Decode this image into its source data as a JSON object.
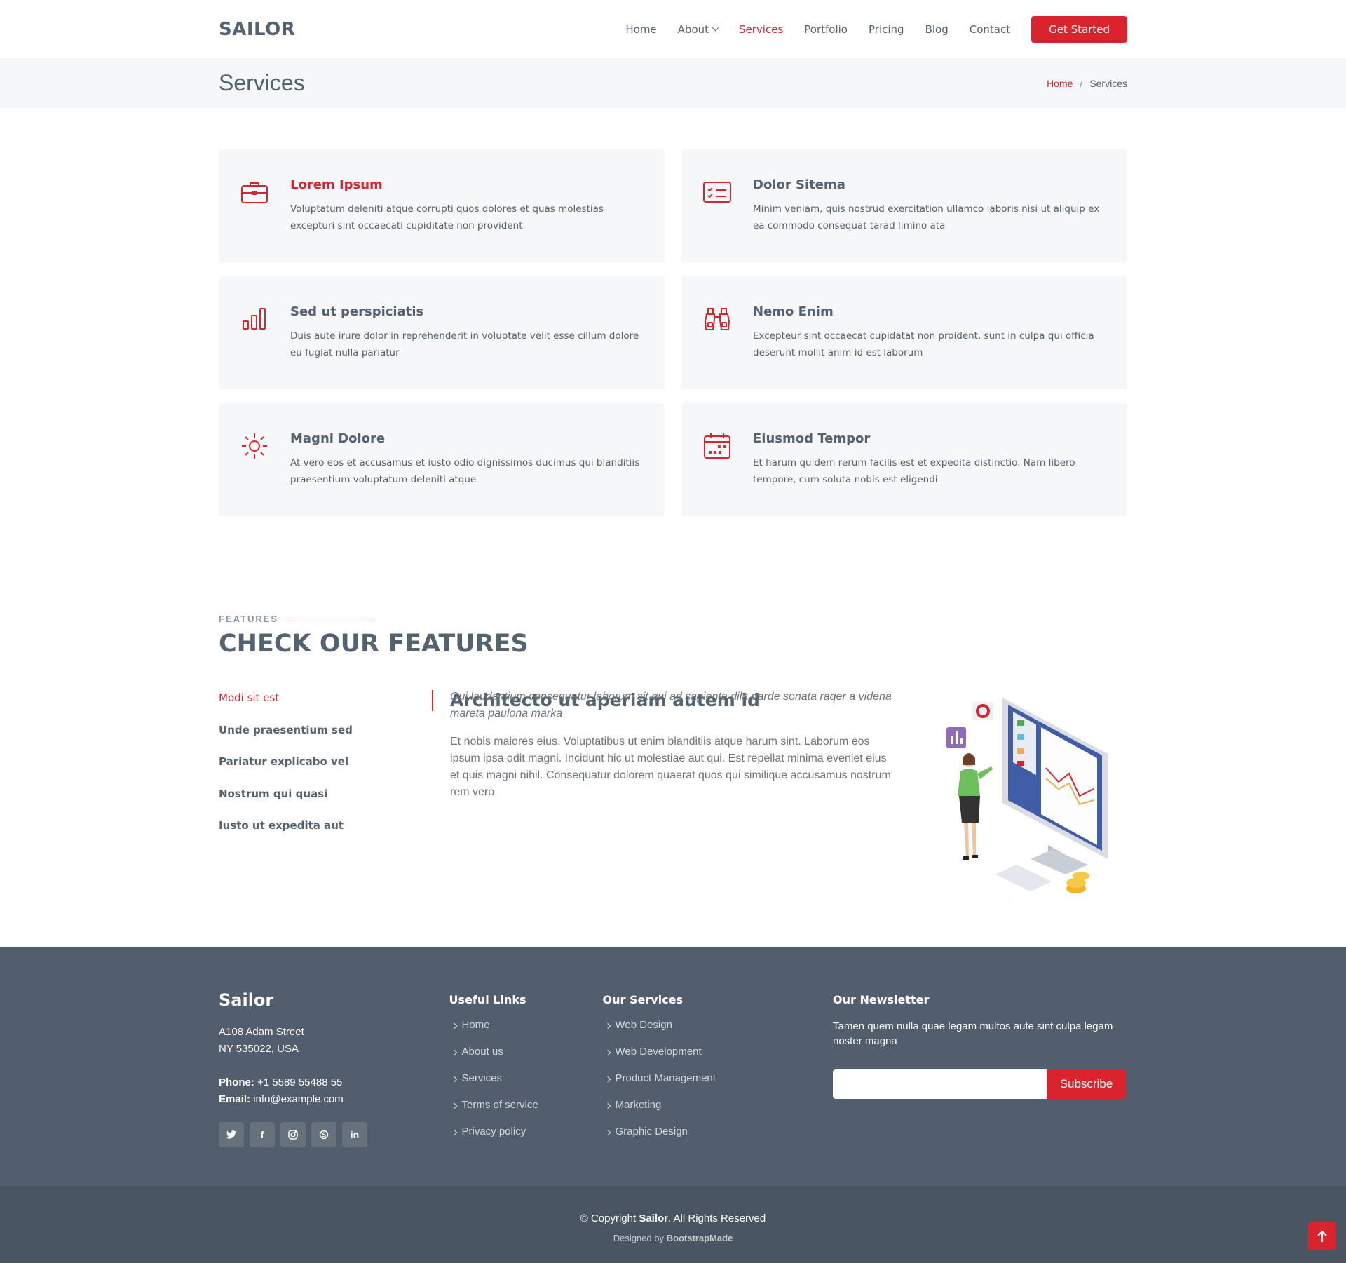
{
  "header": {
    "logo": "SAILOR",
    "nav": [
      "Home",
      "About",
      "Services",
      "Portfolio",
      "Pricing",
      "Blog",
      "Contact"
    ],
    "active": "Services",
    "cta": "Get Started"
  },
  "breadcrumbs": {
    "title": "Services",
    "home": "Home",
    "sep": "/",
    "current": "Services"
  },
  "services": [
    {
      "icon": "briefcase-icon",
      "title": "Lorem Ipsum",
      "text": "Voluptatum deleniti atque corrupti quos dolores et quas molestias excepturi sint occaecati cupiditate non provident"
    },
    {
      "icon": "card-checklist-icon",
      "title": "Dolor Sitema",
      "text": "Minim veniam, quis nostrud exercitation ullamco laboris nisi ut aliquip ex ea commodo consequat tarad limino ata"
    },
    {
      "icon": "bar-chart-icon",
      "title": "Sed ut perspiciatis",
      "text": "Duis aute irure dolor in reprehenderit in voluptate velit esse cillum dolore eu fugiat nulla pariatur"
    },
    {
      "icon": "binoculars-icon",
      "title": "Nemo Enim",
      "text": "Excepteur sint occaecat cupidatat non proident, sunt in culpa qui officia deserunt mollit anim id est laborum"
    },
    {
      "icon": "brightness-icon",
      "title": "Magni Dolore",
      "text": "At vero eos et accusamus et iusto odio dignissimos ducimus qui blanditiis praesentium voluptatum deleniti atque"
    },
    {
      "icon": "calendar-icon",
      "title": "Eiusmod Tempor",
      "text": "Et harum quidem rerum facilis est et expedita distinctio. Nam libero tempore, cum soluta nobis est eligendi"
    }
  ],
  "features": {
    "subtitle": "FEATURES",
    "title": "CHECK OUR FEATURES",
    "tabs": [
      "Modi sit est",
      "Unde praesentium sed",
      "Pariatur explicabo vel",
      "Nostrum qui quasi",
      "Iusto ut expedita aut"
    ],
    "active_tab": "Modi sit est",
    "content": {
      "heading": "Architecto ut aperiam autem id",
      "lead": "Qui laudantium consequatur laborum sit qui ad sapiente dila parde sonata raqer a videna mareta paulona marka",
      "body": "Et nobis maiores eius. Voluptatibus ut enim blanditiis atque harum sint. Laborum eos ipsum ipsa odit magni. Incidunt hic ut molestiae aut qui. Est repellat minima eveniet eius et quis magni nihil. Consequatur dolorem quaerat quos qui similique accusamus nostrum rem vero"
    }
  },
  "footer": {
    "brand": "Sailor",
    "address1": "A108 Adam Street",
    "address2": "NY 535022, USA",
    "phone_label": "Phone:",
    "phone": "+1 5589 55488 55",
    "email_label": "Email:",
    "email": "info@example.com",
    "socials": [
      "twitter-icon",
      "facebook-icon",
      "instagram-icon",
      "skype-icon",
      "linkedin-icon"
    ],
    "useful_title": "Useful Links",
    "useful_links": [
      "Home",
      "About us",
      "Services",
      "Terms of service",
      "Privacy policy"
    ],
    "services_title": "Our Services",
    "services_links": [
      "Web Design",
      "Web Development",
      "Product Management",
      "Marketing",
      "Graphic Design"
    ],
    "newsletter_title": "Our Newsletter",
    "newsletter_text": "Tamen quem nulla quae legam multos aute sint culpa legam noster magna",
    "subscribe": "Subscribe",
    "copyright_prefix": "© Copyright",
    "copyright_brand": "Sailor",
    "copyright_suffix": ". All Rights Reserved",
    "designed_prefix": "Designed by",
    "designed_brand": "BootstrapMade"
  },
  "colors": {
    "accent": "#d9232d",
    "text": "#556270",
    "footer_bg": "#525e6d",
    "footer_bottom_bg": "#4a5563",
    "card_bg": "#f6f7f8"
  }
}
